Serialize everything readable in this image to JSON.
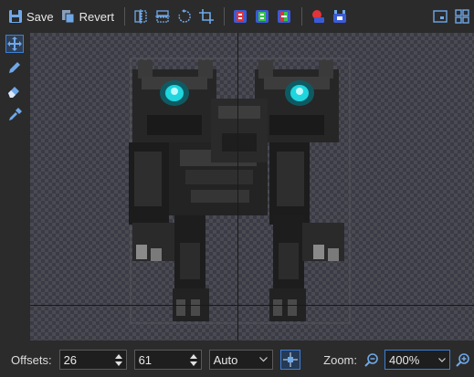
{
  "toolbar": {
    "save_label": "Save",
    "revert_label": "Revert"
  },
  "bottom": {
    "offsets_label": "Offsets:",
    "offset_x": "26",
    "offset_y": "61",
    "alignment": "Auto",
    "zoom_label": "Zoom:",
    "zoom_value": "400%"
  },
  "colors": {
    "accent": "#3d7fd6",
    "background": "#2b2b2b",
    "eye_glow": "#1fd5de"
  },
  "icons": {
    "save": "floppy-disk-icon",
    "revert": "copy-revert-icon",
    "flip_horizontal": "flip-horizontal-icon",
    "flip_vertical": "flip-vertical-icon",
    "rotate": "rotate-icon",
    "crop": "crop-icon",
    "remap_red": "remap-red-icon",
    "remap_green": "remap-green-icon",
    "remap_mixed": "remap-mixed-icon",
    "export_png": "export-png-icon",
    "import_png": "import-png-icon",
    "fit_view": "fit-view-icon",
    "tile_view": "tile-view-icon",
    "move": "move-icon",
    "pencil": "pencil-icon",
    "eraser": "eraser-icon",
    "color_picker": "eyedropper-icon",
    "center_offsets": "center-offsets-icon",
    "zoom_out": "zoom-out-icon",
    "zoom_in": "zoom-in-icon"
  }
}
